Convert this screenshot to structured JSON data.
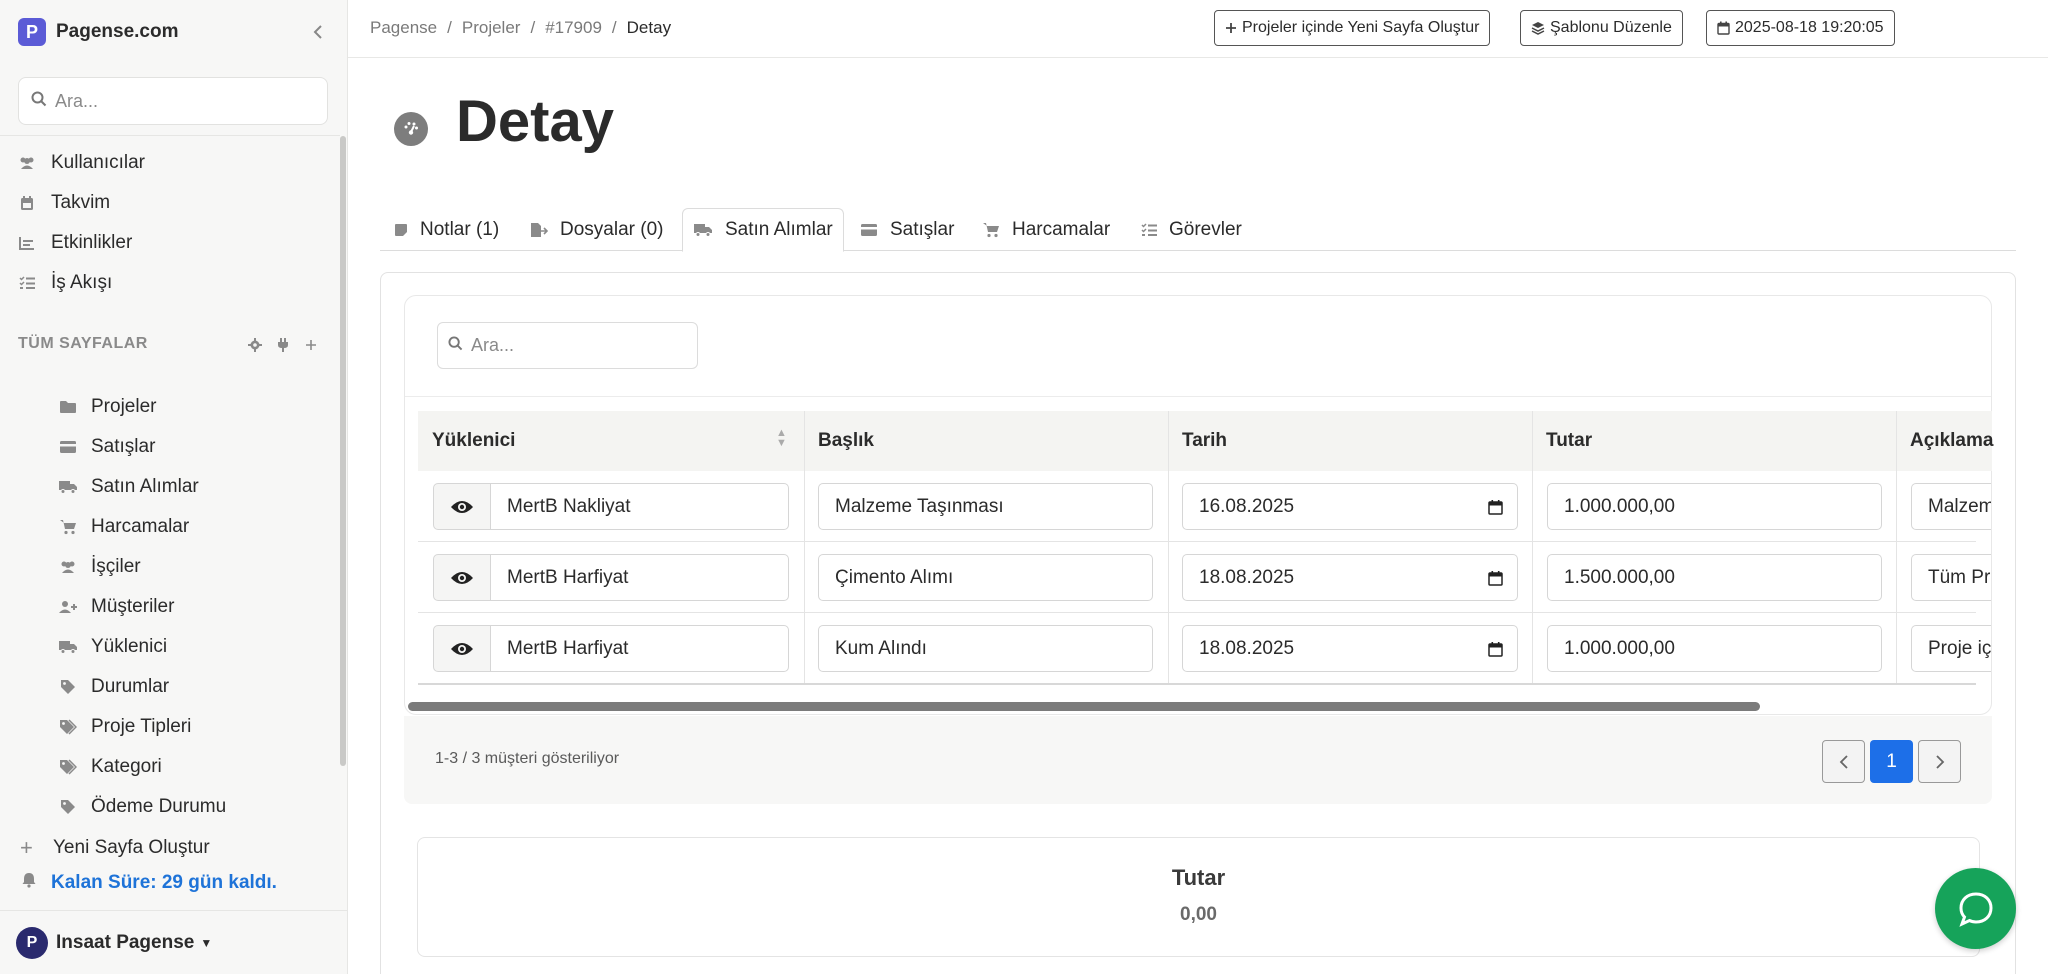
{
  "brand": {
    "name": "Pagense.com",
    "logo_letter": "P"
  },
  "sidebar": {
    "search_placeholder": "Ara...",
    "main_items": [
      {
        "label": "Kullanıcılar",
        "icon": "users-icon"
      },
      {
        "label": "Takvim",
        "icon": "calendar-icon"
      },
      {
        "label": "Etkinlikler",
        "icon": "chart-icon"
      },
      {
        "label": "İş Akışı",
        "icon": "tasks-icon"
      }
    ],
    "section_label": "TÜM SAYFALAR",
    "pages": [
      {
        "label": "Projeler",
        "icon": "folder-icon"
      },
      {
        "label": "Satışlar",
        "icon": "credit-card-icon"
      },
      {
        "label": "Satın Alımlar",
        "icon": "truck-icon"
      },
      {
        "label": "Harcamalar",
        "icon": "cart-icon"
      },
      {
        "label": "İşçiler",
        "icon": "users-icon"
      },
      {
        "label": "Müşteriler",
        "icon": "user-plus-icon"
      },
      {
        "label": "Yüklenici",
        "icon": "truck-icon"
      },
      {
        "label": "Durumlar",
        "icon": "tag-icon"
      },
      {
        "label": "Proje Tipleri",
        "icon": "tags-icon"
      },
      {
        "label": "Kategori",
        "icon": "tags-icon"
      },
      {
        "label": "Ödeme Durumu",
        "icon": "tag-icon"
      }
    ],
    "new_page_label": "Yeni Sayfa Oluştur",
    "remaining_label": "Kalan Süre: 29 gün kaldı.",
    "account_name": "Insaat Pagense",
    "account_initial": "P"
  },
  "breadcrumb": {
    "items": [
      "Pagense",
      "Projeler",
      "#17909"
    ],
    "current": "Detay"
  },
  "toolbar": {
    "new_page_label": "Projeler içinde Yeni Sayfa Oluştur",
    "edit_template_label": "Şablonu Düzenle",
    "datetime_label": "2025-08-18 19:20:05"
  },
  "page": {
    "title": "Detay"
  },
  "tabs": [
    {
      "label": "Notlar (1)",
      "icon": "note-icon"
    },
    {
      "label": "Dosyalar (0)",
      "icon": "file-export-icon"
    },
    {
      "label": "Satın Alımlar",
      "icon": "truck-icon",
      "active": true
    },
    {
      "label": "Satışlar",
      "icon": "credit-card-icon"
    },
    {
      "label": "Harcamalar",
      "icon": "cart-icon"
    },
    {
      "label": "Görevler",
      "icon": "tasks-icon"
    }
  ],
  "table": {
    "search_placeholder": "Ara...",
    "columns": [
      "Yüklenici",
      "Başlık",
      "Tarih",
      "Tutar",
      "Açıklama"
    ],
    "rows": [
      {
        "contractor": "MertB Nakliyat",
        "title": "Malzeme Taşınması",
        "date": "16.08.2025",
        "amount": "1.000.000,00",
        "description": "Malzem"
      },
      {
        "contractor": "MertB Harfiyat",
        "title": "Çimento Alımı",
        "date": "18.08.2025",
        "amount": "1.500.000,00",
        "description": "Tüm Pr"
      },
      {
        "contractor": "MertB Harfiyat",
        "title": "Kum Alındı",
        "date": "18.08.2025",
        "amount": "1.000.000,00",
        "description": "Proje iç"
      }
    ],
    "showing_text": "1-3 / 3 müşteri gösteriliyor",
    "current_page": "1"
  },
  "summary": {
    "label": "Tutar",
    "value": "0,00"
  },
  "colors": {
    "accent": "#1d6fe8",
    "brand": "#5b5bd6",
    "chat": "#16a35a",
    "remaining": "#1e73d8"
  }
}
